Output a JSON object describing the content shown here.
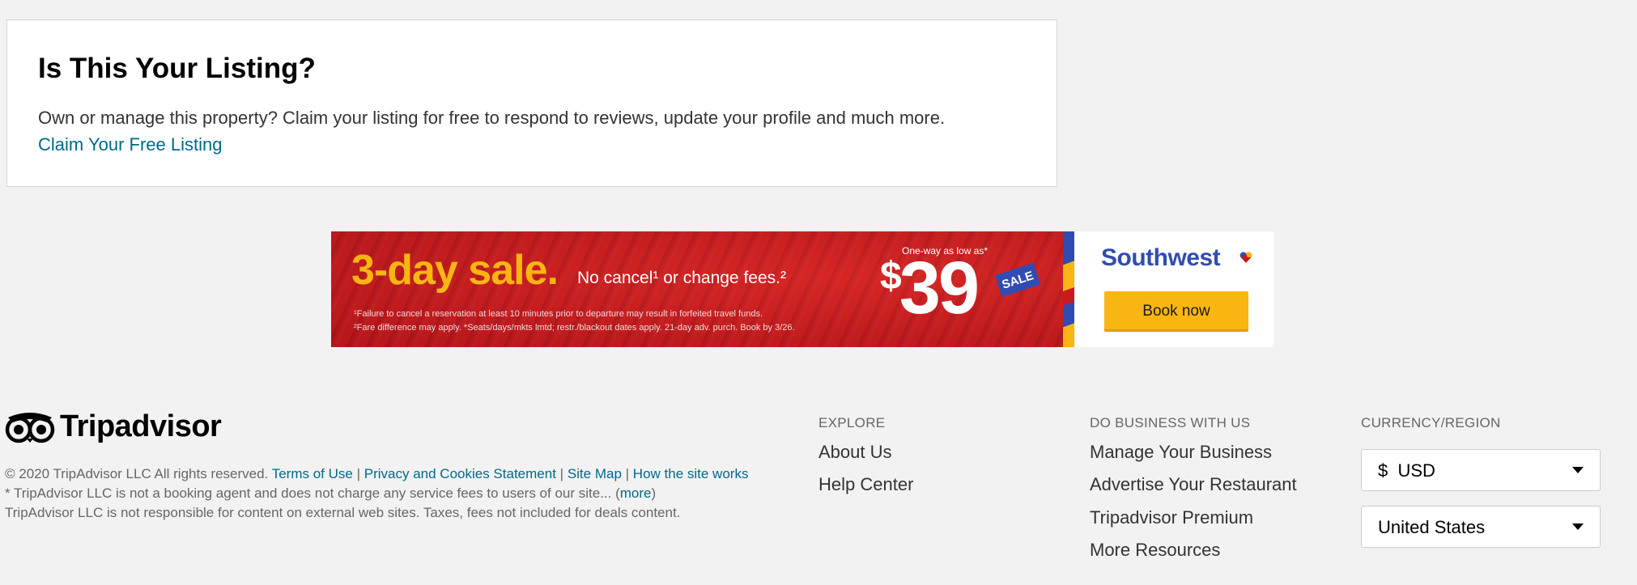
{
  "claim": {
    "title": "Is This Your Listing?",
    "text": "Own or manage this property? Claim your listing for free to respond to reviews, update your profile and much more.",
    "link": "Claim Your Free Listing"
  },
  "ad": {
    "headline": "3-day sale.",
    "subline": "No cancel¹ or change fees.²",
    "fine_print_1": "¹Failure to cancel a reservation at least 10 minutes prior to departure may result in forfeited travel funds.",
    "fine_print_2": "²Fare difference may apply. *Seats/days/mkts lmtd; restr./blackout dates apply. 21-day adv. purch. Book by 3/26.",
    "one_way": "One-way as low as*",
    "price_symbol": "$",
    "price": "39",
    "sale_tag": "SALE",
    "brand": "Southwest",
    "cta": "Book now",
    "colors": {
      "red": "#c8191e",
      "yellow": "#f9b612",
      "blue": "#304cb2"
    }
  },
  "footer": {
    "logo_text": "Tripadvisor",
    "copyright": "© 2020 TripAdvisor LLC All rights reserved.",
    "legal_links": [
      "Terms of Use",
      "Privacy and Cookies Statement",
      "Site Map",
      "How the site works"
    ],
    "disclaimer_1": "* TripAdvisor LLC is not a booking agent and does not charge any service fees to users of our site... (",
    "more_link": "more",
    "disclaimer_1_end": ")",
    "disclaimer_2": "TripAdvisor LLC is not responsible for content on external web sites. Taxes, fees not included for deals content.",
    "explore": {
      "heading": "EXPLORE",
      "links": [
        "About Us",
        "Help Center"
      ]
    },
    "business": {
      "heading": "DO BUSINESS WITH US",
      "links": [
        "Manage Your Business",
        "Advertise Your Restaurant",
        "Tripadvisor Premium",
        "More Resources"
      ]
    },
    "currency": {
      "heading": "CURRENCY/REGION",
      "currency_symbol": "$",
      "currency_value": "USD",
      "region_value": "United States"
    },
    "link_color": "#00698c"
  }
}
